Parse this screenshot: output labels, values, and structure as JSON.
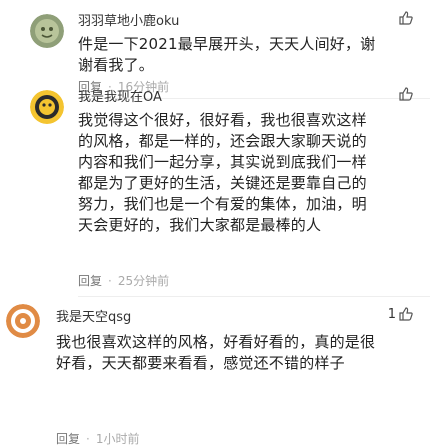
{
  "comments": [
    {
      "username": "羽羽草地小鹿oku",
      "like_count": "",
      "content": "件是一下2021最早展开头，天天人间好，谢谢看我了。",
      "reply_label": "回复",
      "time": "16分钟前",
      "avatar_color": "#8a9a6a"
    },
    {
      "username": "我是我现在OA",
      "like_count": "",
      "content": "我觉得这个很好，很好看，我也很喜欢这样的风格，都是一样的，还会跟大家聊天说的内容和我们一起分享，其实说到底我们一样都是为了更好的生活，关键还是要靠自己的努力，我们也是一个有爱的集体，加油，明天会更好的，我们大家都是最棒的人",
      "reply_label": "回复",
      "time": "25分钟前",
      "avatar_color": "#f1c232"
    },
    {
      "username": "我是天空qsg",
      "like_count": "1",
      "content": "我也很喜欢这样的风格，好看好看的，真的是很好看，天天都要来看看，感觉还不错的样子",
      "reply_label": "回复",
      "time": "1小时前",
      "avatar_color": "#e08840"
    }
  ]
}
